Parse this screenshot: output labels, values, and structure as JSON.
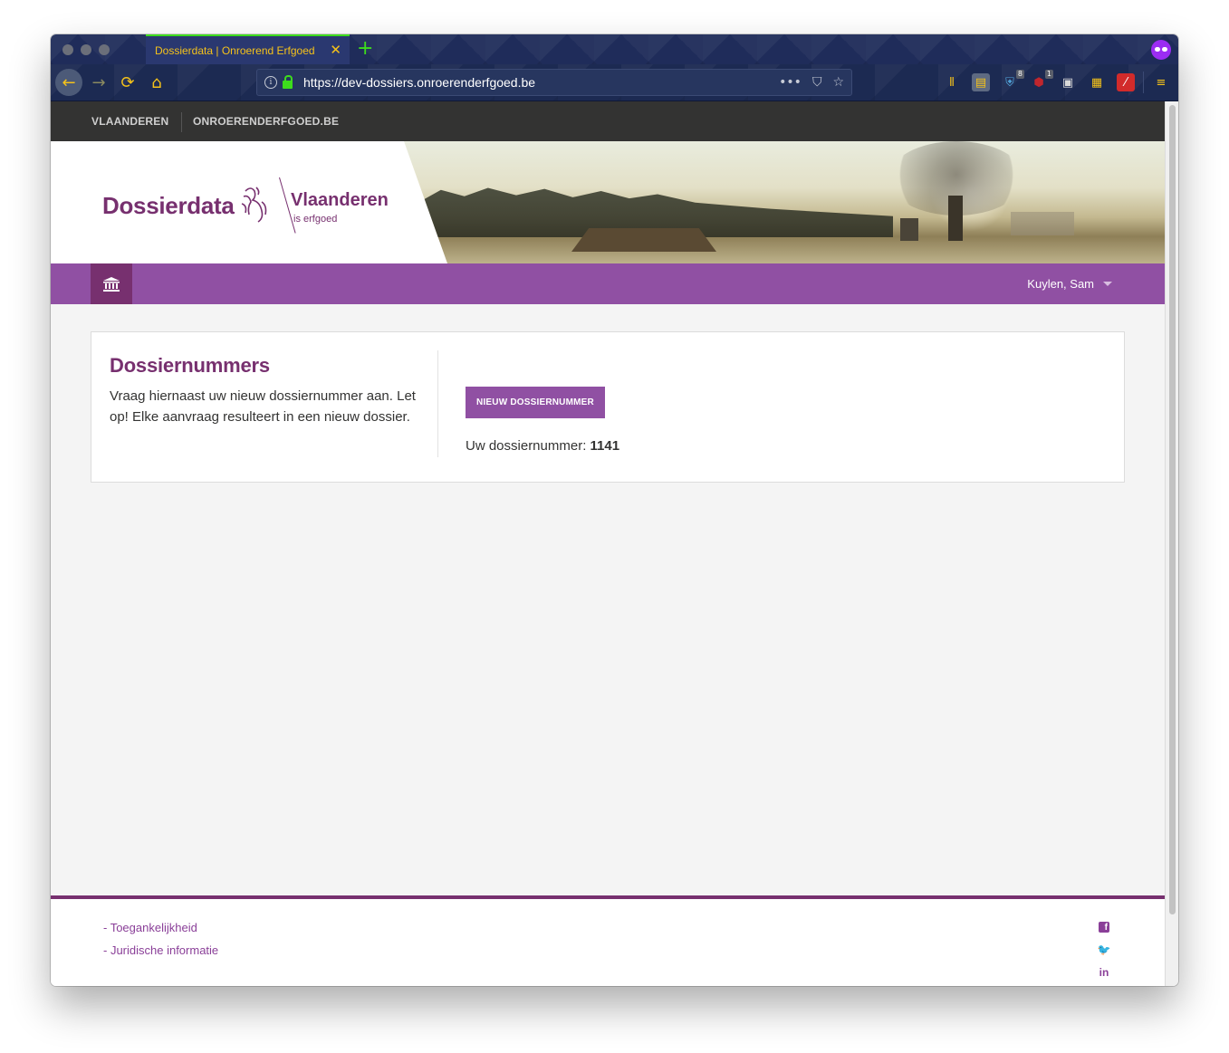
{
  "browser": {
    "tab_title": "Dossierdata | Onroerend Erfgoed",
    "tab_close_glyph": "✕",
    "new_tab_glyph": "+",
    "url": "https://dev-dossiers.onroerenderfgoed.be",
    "url_dots": "•••",
    "badges": {
      "extension_one": "8",
      "extension_two": "1"
    },
    "accent_color": "#f5c21a",
    "secure_color": "#3ddc1c"
  },
  "site_topbar": {
    "links": [
      "VLAANDEREN",
      "ONROERENDERFGOED.BE"
    ]
  },
  "header": {
    "brand": "Dossierdata",
    "vlaanderen_title": "Vlaanderen",
    "vlaanderen_subtitle": "is erfgoed",
    "brand_color": "#77306f"
  },
  "nav": {
    "user_name": "Kuylen, Sam",
    "bar_color": "#9050a3"
  },
  "card": {
    "title": "Dossiernummers",
    "description": "Vraag hiernaast uw nieuw dossiernummer aan. Let op! Elke aanvraag resulteert in een nieuw dossier.",
    "button_label": "NIEUW DOSSIERNUMMER",
    "result_label": "Uw dossiernummer:",
    "result_value": "1141"
  },
  "footer": {
    "links": [
      "- Toegankelijkheid",
      "- Juridische informatie"
    ],
    "social": [
      "facebook-icon",
      "twitter-icon",
      "linkedin-icon"
    ],
    "twitter_glyph": "🐦",
    "linkedin_glyph": "in"
  }
}
